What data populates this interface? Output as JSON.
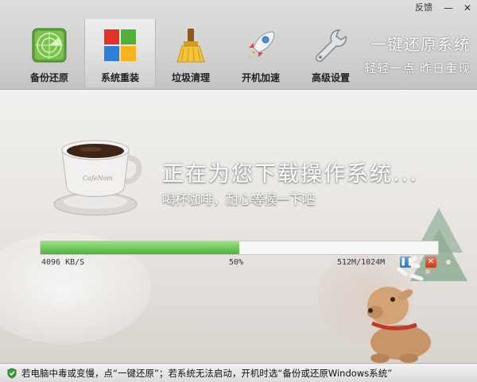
{
  "window": {
    "feedback_label": "反馈",
    "minimize_glyph": "—",
    "close_glyph": "✕"
  },
  "nav": {
    "items": [
      {
        "label": "备份还原",
        "icon": "radar-icon"
      },
      {
        "label": "系统重装",
        "icon": "windows-logo-icon",
        "active": true
      },
      {
        "label": "垃圾清理",
        "icon": "broom-icon"
      },
      {
        "label": "开机加速",
        "icon": "rocket-icon"
      },
      {
        "label": "高级设置",
        "icon": "wrench-icon"
      }
    ]
  },
  "slogan": {
    "line1": "一键还原系统",
    "line2": "轻轻一点 昨日重现"
  },
  "main": {
    "title": "正在为您下载操作系统...",
    "subtitle": "喝杯咖啡，耐心等候一下吧",
    "cup_text": "CafeNom"
  },
  "progress": {
    "speed": "4096 KB/S",
    "percent_text": "50%",
    "size_text": "512M/1024M",
    "value": 0.5,
    "pause_glyph": "❚❚",
    "stop_glyph": "✕"
  },
  "status": {
    "text": "若电脑中毒或变慢，点“一键还原”；若系统无法启动，开机时选“备份或还原Windows系统”",
    "icon": "shield-check-icon"
  },
  "colors": {
    "progress_fill": "#4cb53a",
    "pause_button": "#2a73c8",
    "stop_button": "#c53b1e"
  }
}
